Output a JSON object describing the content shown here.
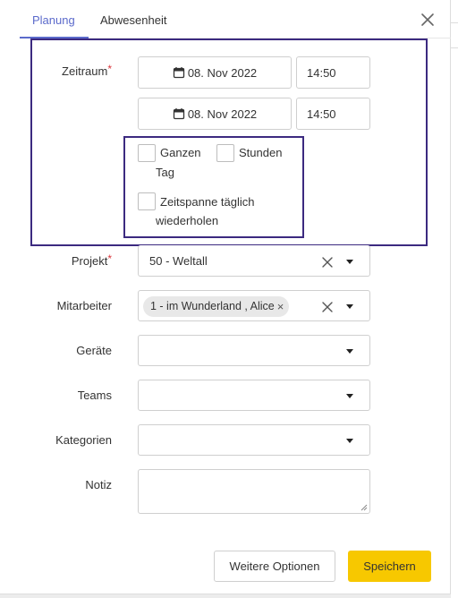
{
  "tabs": [
    {
      "label": "Planung",
      "active": true
    },
    {
      "label": "Abwesenheit",
      "active": false
    }
  ],
  "form": {
    "zeitraum": {
      "label": "Zeitraum",
      "required_mark": "*",
      "start_date": "08. Nov 2022",
      "start_time": "14:50",
      "end_date": "08. Nov 2022",
      "end_time": "14:50"
    },
    "checkboxes": {
      "ganzen_tag": {
        "line1": "Ganzen",
        "line2": "Tag",
        "checked": false
      },
      "stunden": {
        "label": "Stunden",
        "checked": false
      },
      "wiederholen": {
        "line1": "Zeitspanne täglich",
        "line2": "wiederholen",
        "checked": false
      }
    },
    "projekt": {
      "label": "Projekt",
      "required_mark": "*",
      "value": "50 - Weltall"
    },
    "mitarbeiter": {
      "label": "Mitarbeiter",
      "chip": "1 - im Wunderland , Alice",
      "chip_remove": "×"
    },
    "geraete": {
      "label": "Geräte",
      "value": ""
    },
    "teams": {
      "label": "Teams",
      "value": ""
    },
    "kategorien": {
      "label": "Kategorien",
      "value": ""
    },
    "notiz": {
      "label": "Notiz",
      "value": ""
    }
  },
  "buttons": {
    "more": "Weitere Optionen",
    "save": "Speichern"
  },
  "colors": {
    "accent": "#5b6acb",
    "highlight": "#3c2a80",
    "required": "#d9343a",
    "save_button": "#f7c800"
  },
  "icons": [
    "close-icon",
    "calendar-icon",
    "clear-icon",
    "chevron-down-icon"
  ]
}
